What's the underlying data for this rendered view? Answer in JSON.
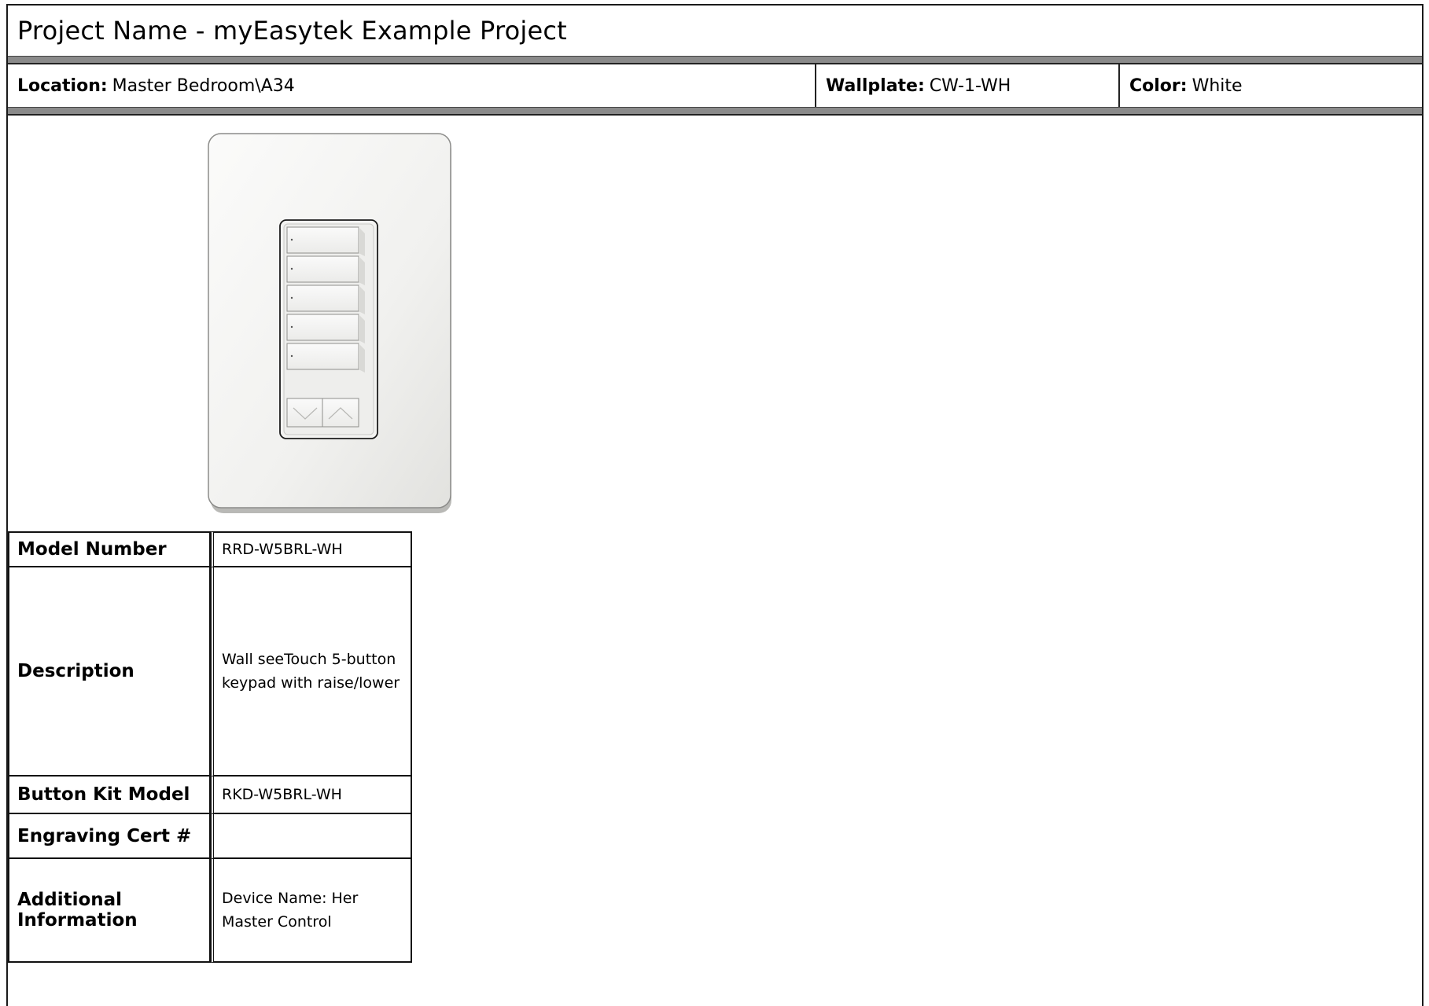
{
  "header": {
    "title": "Project Name - myEasytek Example Project"
  },
  "info": {
    "location_label": "Location:",
    "location_value": "Master Bedroom\\A34",
    "wallplate_label": "Wallplate:",
    "wallplate_value": "CW-1-WH",
    "color_label": "Color:",
    "color_value": "White"
  },
  "device": {
    "image_name": "seetouch-5-button-raise-lower-keypad",
    "button_count": 5,
    "has_raise_lower": true,
    "plate_color": "#f4f4f2"
  },
  "specs": {
    "model_number_label": "Model Number",
    "model_number_value": "RRD-W5BRL-WH",
    "description_label": "Description",
    "description_value": "Wall seeTouch 5-button keypad with raise/lower",
    "button_kit_label": "Button Kit Model",
    "button_kit_value": "RKD-W5BRL-WH",
    "engraving_label": "Engraving Cert #",
    "engraving_value": "",
    "additional_label": "Additional Information",
    "additional_value": "Device Name: Her Master Control"
  }
}
